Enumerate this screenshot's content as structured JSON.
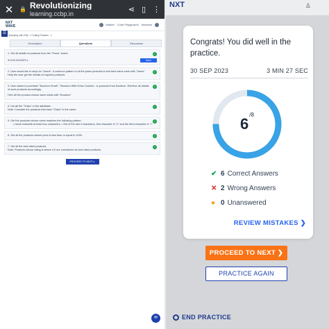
{
  "left": {
    "browser": {
      "page_title": "Revolutionizing",
      "url": "learning.ccbp.in"
    },
    "site": {
      "logo_line1": "NXT",
      "logo_line2": "WAVE",
      "nav_items": [
        "Market",
        "Code Playground",
        "Nxtwave"
      ],
      "breadcrumb": "Querying with SQL > Coding Practice - 1"
    },
    "tabs": [
      "Description",
      "Questions",
      "Discussion"
    ],
    "questions": [
      {
        "text": "1. Get all details of products from the \"Puma\" brand.",
        "note": "",
        "link": "SHOW ANSWER ▸",
        "button": "Save"
      },
      {
        "text": "2. User would like to shop for \"Jeans\". A common pattern in all the jeans products is that their name ends with \"Jeans\". Help the user get the details of required products.",
        "note": ""
      },
      {
        "text": "3. User wants to purchase \"Bourbon Small\", \"Bourbon With Extra Cookies\", or products from Bourbon. Retrieve all details of such products accordingly.",
        "note": "Hint: All the product whose name starts with \"Bourbon\"."
      },
      {
        "text": "4. List all the \"Chips\" in the database.",
        "note": "Note: Consider the products that have \"Chips\" in the name."
      },
      {
        "text": "5. Get the products whose name matches the following pattern:",
        "note": "• name endswith at least four characters,  • Out of the last 4 characters, first character is \"h\" and the third character is \"r\"."
      },
      {
        "text": "6. Get all the products whose price is less than or equal to 1000.",
        "note": ""
      },
      {
        "text": "7. Get all the best rated products.",
        "note": "Note: Products whose rating is above 4.0 are considered as best rated products."
      }
    ],
    "proceed_label": "PROCEED TO NEXT ▸"
  },
  "right": {
    "logo": "NXT",
    "card": {
      "message": "Congrats! You did well in the practice.",
      "date": "30 SEP 2023",
      "duration": "3 MIN 27 SEC",
      "score": "6",
      "total": "/8",
      "correct_count": "6",
      "correct_label": "Correct Answers",
      "wrong_count": "2",
      "wrong_label": "Wrong Answers",
      "unanswered_count": "0",
      "unanswered_label": "Unanswered",
      "review_label": "REVIEW MISTAKES ❯"
    },
    "proceed_label": "PROCEED TO NEXT ❯",
    "practice_again_label": "PRACTICE AGAIN",
    "end_practice_label": "END PRACTICE"
  },
  "progress": {
    "correct": 6,
    "total": 8
  },
  "colors": {
    "accent": "#2563eb",
    "gauge_fill": "#38a3e6",
    "gauge_track": "#e2e8f0",
    "proceed": "#f97316"
  }
}
